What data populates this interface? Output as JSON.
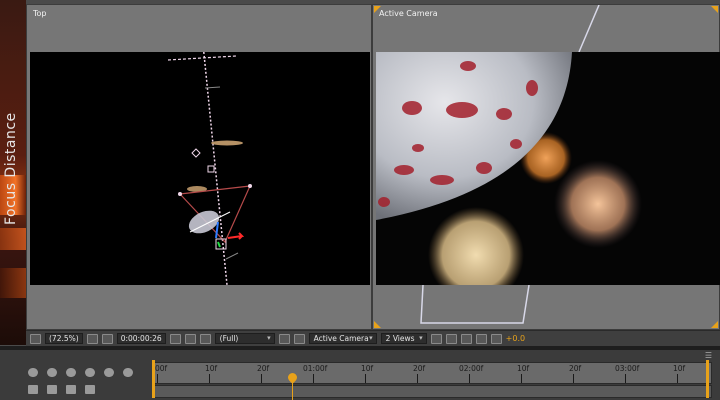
{
  "side_panel": {
    "title": "Focus Distance"
  },
  "viewers": {
    "left": {
      "label": "Top"
    },
    "right": {
      "label": "Active Camera"
    }
  },
  "viewer_toolbar": {
    "zoom": "(72.5%)",
    "timecode": "0:00:00:26",
    "resolution": "(Full)",
    "camera": "Active Camera",
    "views": "2 Views",
    "exposure": "+0.0"
  },
  "timeline": {
    "ruler_labels": [
      "00f",
      "10f",
      "20f",
      "01:00f",
      "10f",
      "20f",
      "02:00f",
      "10f",
      "20f",
      "03:00f",
      "10f"
    ],
    "current_frame_label": "01:00f"
  },
  "colors": {
    "accent": "#e8a21a",
    "panel": "#767676",
    "toolbar": "#3f3f3f"
  }
}
